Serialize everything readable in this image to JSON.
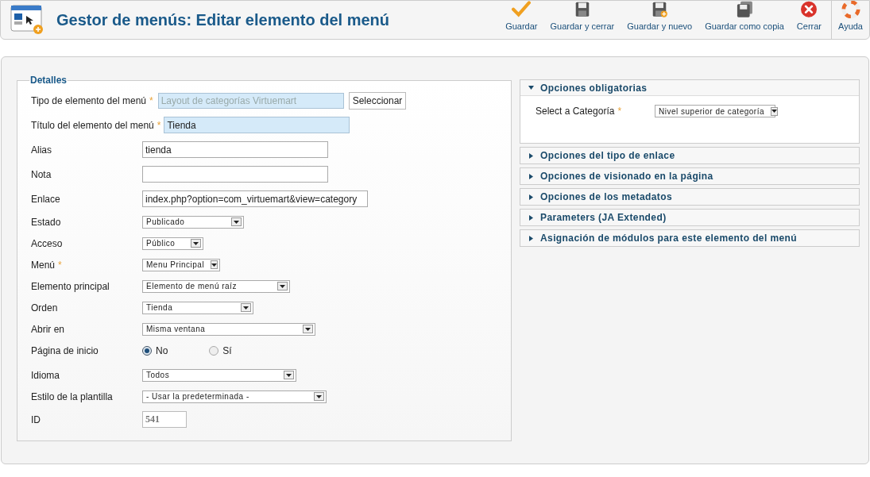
{
  "header": {
    "title": "Gestor de menús: Editar elemento del menú"
  },
  "toolbar": [
    {
      "kind": "check",
      "label": "Guardar"
    },
    {
      "kind": "disk",
      "label": "Guardar y cerrar"
    },
    {
      "kind": "disk-plus",
      "label": "Guardar y nuevo"
    },
    {
      "kind": "disks",
      "label": "Guardar como copia"
    },
    {
      "kind": "close",
      "label": "Cerrar"
    },
    {
      "kind": "help",
      "label": "Ayuda"
    }
  ],
  "details": {
    "legend": "Detalles",
    "fields": [
      {
        "kind": "readonly",
        "label": "Tipo de elemento del menú",
        "mark": "*",
        "value": "Layout de categorías Virtuemart",
        "button": "Seleccionar"
      },
      {
        "kind": "text",
        "label": "Título del elemento del menú",
        "mark": "*",
        "value": "Tienda",
        "highlighted": true
      },
      {
        "kind": "text",
        "label": "Alias",
        "value": "tienda",
        "highlighted": false
      },
      {
        "kind": "text",
        "label": "Nota",
        "highlighted": false
      },
      {
        "kind": "text",
        "label": "Enlace",
        "value": "index.php?option=com_virtuemart&view=category",
        "highlighted": false
      },
      {
        "kind": "select",
        "label": "Estado",
        "value": "Publicado"
      },
      {
        "kind": "select",
        "label": "Acceso",
        "value": "Público"
      },
      {
        "kind": "select",
        "label": "Menú",
        "mark": "*",
        "value": "Menu Principal"
      },
      {
        "kind": "select",
        "label": "Elemento principal",
        "value": "Elemento de menú raíz"
      },
      {
        "kind": "select",
        "label": "Orden",
        "value": "Tienda"
      },
      {
        "kind": "select",
        "label": "Abrir en",
        "value": "Misma ventana"
      },
      {
        "kind": "radio",
        "label": "Página de inicio",
        "options": [
          {
            "label": "No",
            "selected": true
          },
          {
            "label": "Sí",
            "selected": false
          }
        ]
      },
      {
        "kind": "select",
        "label": "Idioma",
        "value": "Todos"
      },
      {
        "kind": "select",
        "label": "Estilo de la plantilla",
        "value": "- Usar la predeterminada -"
      },
      {
        "kind": "id",
        "label": "ID",
        "value": "541"
      }
    ]
  },
  "panels": [
    {
      "title": "Opciones obligatorias",
      "expanded": true,
      "fields": [
        {
          "label": "Select a Categoría",
          "mark": "*",
          "value": "Nivel superior de categoría"
        }
      ]
    },
    {
      "title": "Opciones del tipo de enlace",
      "expanded": false
    },
    {
      "title": "Opciones de visionado en la página",
      "expanded": false
    },
    {
      "title": "Opciones de los metadatos",
      "expanded": false
    },
    {
      "title": "Parameters (JA Extended)",
      "expanded": false
    },
    {
      "title": "Asignación de módulos para este elemento del menú",
      "expanded": false
    }
  ]
}
